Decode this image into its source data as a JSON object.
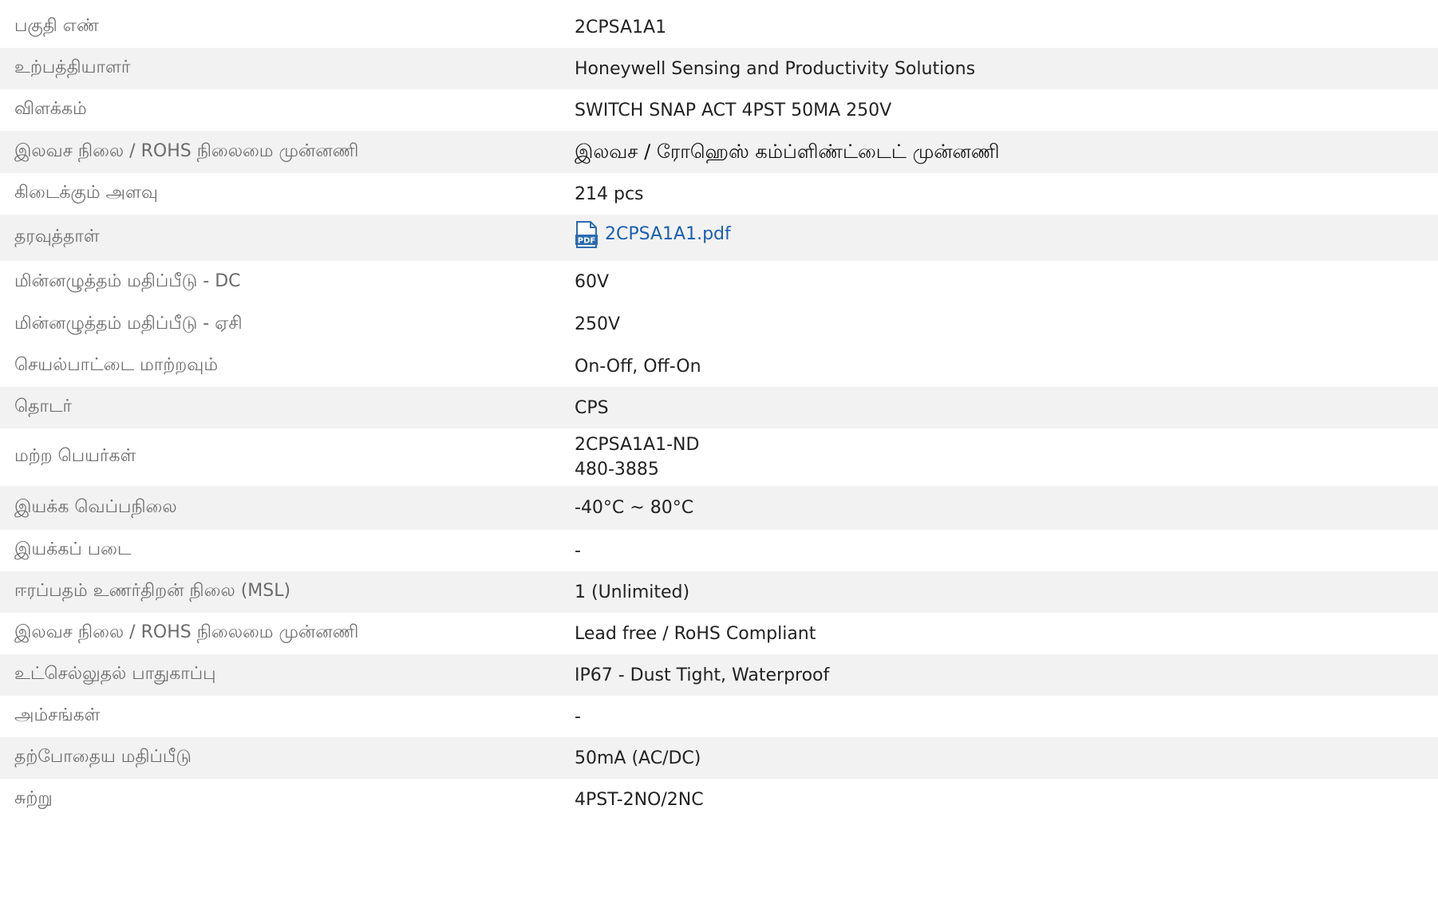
{
  "rows": [
    {
      "label": "பகுதி எண்",
      "value": "2CPSA1A1"
    },
    {
      "label": "உற்பத்தியாளர்",
      "value": "Honeywell Sensing and Productivity Solutions"
    },
    {
      "label": "விளக்கம்",
      "value": "SWITCH SNAP ACT 4PST 50MA 250V"
    },
    {
      "label": "இலவச நிலை / ROHS நிலைமை முன்னணி",
      "value": "இலவச / ரோஹெஸ் கம்ப்ளிண்ட்டைட் முன்னணி"
    },
    {
      "label": "கிடைக்கும் அளவு",
      "value": "214 pcs"
    },
    {
      "label": "தரவுத்தாள்",
      "value": "2CPSA1A1.pdf",
      "icon": "pdf-file-icon"
    },
    {
      "label": "மின்னழுத்தம் மதிப்பீடு - DC",
      "value": "60V"
    },
    {
      "label": "மின்னழுத்தம் மதிப்பீடு - ஏசி",
      "value": "250V"
    },
    {
      "label": "செயல்பாட்டை மாற்றவும்",
      "value": "On-Off, Off-On"
    },
    {
      "label": "தொடர்",
      "value": "CPS"
    },
    {
      "label": "மற்ற பெயர்கள்",
      "value_lines": [
        "2CPSA1A1-ND",
        "480-3885"
      ]
    },
    {
      "label": "இயக்க வெப்பநிலை",
      "value": "-40°C ~ 80°C"
    },
    {
      "label": "இயக்கப் படை",
      "value": "-"
    },
    {
      "label": "ஈரப்பதம் உணர்திறன் நிலை (MSL)",
      "value": "1 (Unlimited)"
    },
    {
      "label": "இலவச நிலை / ROHS நிலைமை முன்னணி",
      "value": "Lead free / RoHS Compliant"
    },
    {
      "label": "உட்செல்லுதல் பாதுகாப்பு",
      "value": "IP67 - Dust Tight, Waterproof"
    },
    {
      "label": "அம்சங்கள்",
      "value": "-"
    },
    {
      "label": "தற்போதைய மதிப்பீடு",
      "value": "50mA (AC/DC)"
    },
    {
      "label": "சுற்று",
      "value": "4PST-2NO/2NC"
    }
  ],
  "colors": {
    "row_alt_bg": "#f2f2f2",
    "label_text": "#6b6b6b",
    "value_text": "#222222",
    "link": "#1a5fb4",
    "pdf_icon": "#2b6cb0"
  }
}
